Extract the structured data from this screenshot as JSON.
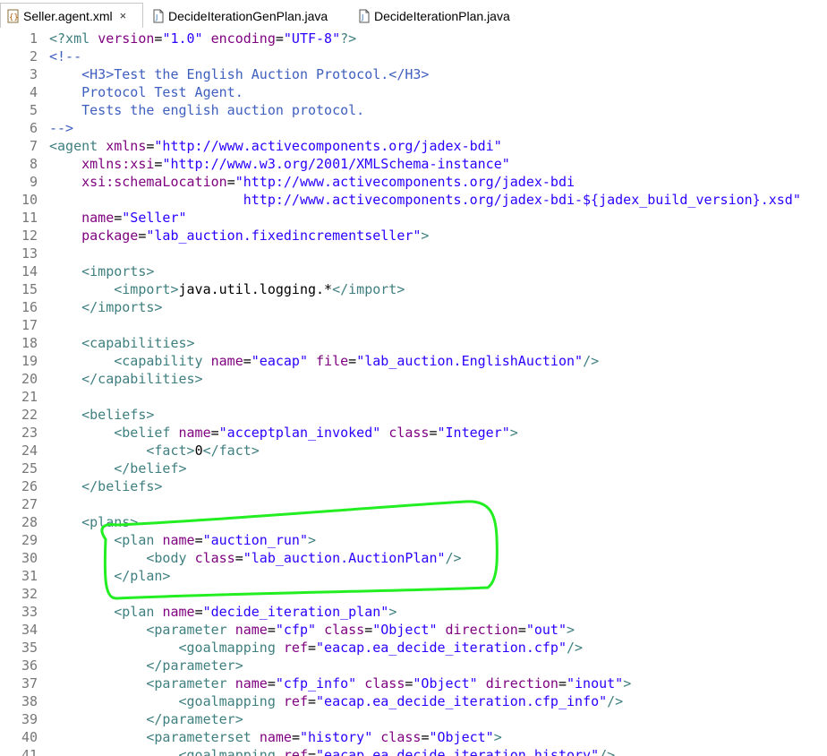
{
  "tabs": [
    {
      "label": "Seller.agent.xml",
      "active": true,
      "icon": "xml-file-icon",
      "close": "×"
    },
    {
      "label": "DecideIterationGenPlan.java",
      "active": false,
      "icon": "java-file-icon"
    },
    {
      "label": "DecideIterationPlan.java",
      "active": false,
      "icon": "java-file-icon"
    }
  ],
  "colors": {
    "tag": "#3f7f7f",
    "attribute": "#7f007f",
    "string": "#2a00ff",
    "comment": "#3f5fbf",
    "line_number": "#787878",
    "annotation": "#22ee22"
  },
  "editor": {
    "lines": [
      {
        "n": "1",
        "segs": [
          [
            "tag",
            "<?xml "
          ],
          [
            "attr",
            "version"
          ],
          [
            "txt",
            "="
          ],
          [
            "str",
            "\"1.0\""
          ],
          [
            "txt",
            " "
          ],
          [
            "attr",
            "encoding"
          ],
          [
            "txt",
            "="
          ],
          [
            "str",
            "\"UTF-8\""
          ],
          [
            "tag",
            "?>"
          ]
        ]
      },
      {
        "n": "2",
        "segs": [
          [
            "com",
            "<!--"
          ]
        ]
      },
      {
        "n": "3",
        "segs": [
          [
            "com",
            "    <H3>Test the English Auction Protocol.</H3>"
          ]
        ]
      },
      {
        "n": "4",
        "segs": [
          [
            "com",
            "    Protocol Test Agent."
          ]
        ]
      },
      {
        "n": "5",
        "segs": [
          [
            "com",
            "    Tests the english auction protocol."
          ]
        ]
      },
      {
        "n": "6",
        "segs": [
          [
            "com",
            "-->"
          ]
        ]
      },
      {
        "n": "7",
        "segs": [
          [
            "tag",
            "<agent "
          ],
          [
            "attr",
            "xmlns"
          ],
          [
            "txt",
            "="
          ],
          [
            "str",
            "\"http://www.activecomponents.org/jadex-bdi\""
          ]
        ]
      },
      {
        "n": "8",
        "segs": [
          [
            "txt",
            "    "
          ],
          [
            "attr",
            "xmlns:xsi"
          ],
          [
            "txt",
            "="
          ],
          [
            "str",
            "\"http://www.w3.org/2001/XMLSchema-instance\""
          ]
        ]
      },
      {
        "n": "9",
        "segs": [
          [
            "txt",
            "    "
          ],
          [
            "attr",
            "xsi:schemaLocation"
          ],
          [
            "txt",
            "="
          ],
          [
            "str",
            "\"http://www.activecomponents.org/jadex-bdi"
          ]
        ]
      },
      {
        "n": "10",
        "segs": [
          [
            "str",
            "                        http://www.activecomponents.org/jadex-bdi-${jadex_build_version}.xsd\""
          ]
        ]
      },
      {
        "n": "11",
        "segs": [
          [
            "txt",
            "    "
          ],
          [
            "attr",
            "name"
          ],
          [
            "txt",
            "="
          ],
          [
            "str",
            "\"Seller\""
          ]
        ]
      },
      {
        "n": "12",
        "segs": [
          [
            "txt",
            "    "
          ],
          [
            "attr",
            "package"
          ],
          [
            "txt",
            "="
          ],
          [
            "str",
            "\"lab_auction.fixedincrementseller\""
          ],
          [
            "tag",
            ">"
          ]
        ]
      },
      {
        "n": "13",
        "segs": []
      },
      {
        "n": "14",
        "segs": [
          [
            "tag",
            "    <imports>"
          ]
        ]
      },
      {
        "n": "15",
        "segs": [
          [
            "tag",
            "        <import>"
          ],
          [
            "txt",
            "java.util.logging.*"
          ],
          [
            "tag",
            "</import>"
          ]
        ]
      },
      {
        "n": "16",
        "segs": [
          [
            "tag",
            "    </imports>"
          ]
        ]
      },
      {
        "n": "17",
        "segs": []
      },
      {
        "n": "18",
        "segs": [
          [
            "tag",
            "    <capabilities>"
          ]
        ]
      },
      {
        "n": "19",
        "segs": [
          [
            "tag",
            "        <capability "
          ],
          [
            "attr",
            "name"
          ],
          [
            "txt",
            "="
          ],
          [
            "str",
            "\"eacap\""
          ],
          [
            "txt",
            " "
          ],
          [
            "attr",
            "file"
          ],
          [
            "txt",
            "="
          ],
          [
            "str",
            "\"lab_auction.EnglishAuction\""
          ],
          [
            "tag",
            "/>"
          ]
        ]
      },
      {
        "n": "20",
        "segs": [
          [
            "tag",
            "    </capabilities>"
          ]
        ]
      },
      {
        "n": "21",
        "segs": []
      },
      {
        "n": "22",
        "segs": [
          [
            "tag",
            "    <beliefs>"
          ]
        ]
      },
      {
        "n": "23",
        "segs": [
          [
            "tag",
            "        <belief "
          ],
          [
            "attr",
            "name"
          ],
          [
            "txt",
            "="
          ],
          [
            "str",
            "\"acceptplan_invoked\""
          ],
          [
            "txt",
            " "
          ],
          [
            "attr",
            "class"
          ],
          [
            "txt",
            "="
          ],
          [
            "str",
            "\"Integer\""
          ],
          [
            "tag",
            ">"
          ]
        ]
      },
      {
        "n": "24",
        "segs": [
          [
            "tag",
            "            <fact>"
          ],
          [
            "txt",
            "0"
          ],
          [
            "tag",
            "</fact>"
          ]
        ]
      },
      {
        "n": "25",
        "segs": [
          [
            "tag",
            "        </belief>"
          ]
        ]
      },
      {
        "n": "26",
        "segs": [
          [
            "tag",
            "    </beliefs>"
          ]
        ]
      },
      {
        "n": "27",
        "segs": []
      },
      {
        "n": "28",
        "segs": [
          [
            "tag",
            "    <plans>"
          ]
        ]
      },
      {
        "n": "29",
        "segs": [
          [
            "tag",
            "        <plan "
          ],
          [
            "attr",
            "name"
          ],
          [
            "txt",
            "="
          ],
          [
            "str",
            "\"auction_run\""
          ],
          [
            "tag",
            ">"
          ]
        ]
      },
      {
        "n": "30",
        "segs": [
          [
            "tag",
            "            <body "
          ],
          [
            "attr",
            "class"
          ],
          [
            "txt",
            "="
          ],
          [
            "str",
            "\"lab_auction.AuctionPlan\""
          ],
          [
            "tag",
            "/>"
          ]
        ]
      },
      {
        "n": "31",
        "segs": [
          [
            "tag",
            "        </plan>"
          ]
        ]
      },
      {
        "n": "32",
        "segs": []
      },
      {
        "n": "33",
        "segs": [
          [
            "tag",
            "        <plan "
          ],
          [
            "attr",
            "name"
          ],
          [
            "txt",
            "="
          ],
          [
            "str",
            "\"decide_iteration_plan\""
          ],
          [
            "tag",
            ">"
          ]
        ]
      },
      {
        "n": "34",
        "segs": [
          [
            "tag",
            "            <parameter "
          ],
          [
            "attr",
            "name"
          ],
          [
            "txt",
            "="
          ],
          [
            "str",
            "\"cfp\""
          ],
          [
            "txt",
            " "
          ],
          [
            "attr",
            "class"
          ],
          [
            "txt",
            "="
          ],
          [
            "str",
            "\"Object\""
          ],
          [
            "txt",
            " "
          ],
          [
            "attr",
            "direction"
          ],
          [
            "txt",
            "="
          ],
          [
            "str",
            "\"out\""
          ],
          [
            "tag",
            ">"
          ]
        ]
      },
      {
        "n": "35",
        "segs": [
          [
            "tag",
            "                <goalmapping "
          ],
          [
            "attr",
            "ref"
          ],
          [
            "txt",
            "="
          ],
          [
            "str",
            "\"eacap.ea_decide_iteration.cfp\""
          ],
          [
            "tag",
            "/>"
          ]
        ]
      },
      {
        "n": "36",
        "segs": [
          [
            "tag",
            "            </parameter>"
          ]
        ]
      },
      {
        "n": "37",
        "segs": [
          [
            "tag",
            "            <parameter "
          ],
          [
            "attr",
            "name"
          ],
          [
            "txt",
            "="
          ],
          [
            "str",
            "\"cfp_info\""
          ],
          [
            "txt",
            " "
          ],
          [
            "attr",
            "class"
          ],
          [
            "txt",
            "="
          ],
          [
            "str",
            "\"Object\""
          ],
          [
            "txt",
            " "
          ],
          [
            "attr",
            "direction"
          ],
          [
            "txt",
            "="
          ],
          [
            "str",
            "\"inout\""
          ],
          [
            "tag",
            ">"
          ]
        ]
      },
      {
        "n": "38",
        "segs": [
          [
            "tag",
            "                <goalmapping "
          ],
          [
            "attr",
            "ref"
          ],
          [
            "txt",
            "="
          ],
          [
            "str",
            "\"eacap.ea_decide_iteration.cfp_info\""
          ],
          [
            "tag",
            "/>"
          ]
        ]
      },
      {
        "n": "39",
        "segs": [
          [
            "tag",
            "            </parameter>"
          ]
        ]
      },
      {
        "n": "40",
        "segs": [
          [
            "tag",
            "            <parameterset "
          ],
          [
            "attr",
            "name"
          ],
          [
            "txt",
            "="
          ],
          [
            "str",
            "\"history\""
          ],
          [
            "txt",
            " "
          ],
          [
            "attr",
            "class"
          ],
          [
            "txt",
            "="
          ],
          [
            "str",
            "\"Object\""
          ],
          [
            "tag",
            ">"
          ]
        ]
      },
      {
        "n": "41",
        "segs": [
          [
            "tag",
            "                <goalmapping "
          ],
          [
            "attr",
            "ref"
          ],
          [
            "txt",
            "="
          ],
          [
            "str",
            "\"eacap.ea_decide_iteration.history\""
          ],
          [
            "tag",
            "/>"
          ]
        ]
      }
    ]
  }
}
